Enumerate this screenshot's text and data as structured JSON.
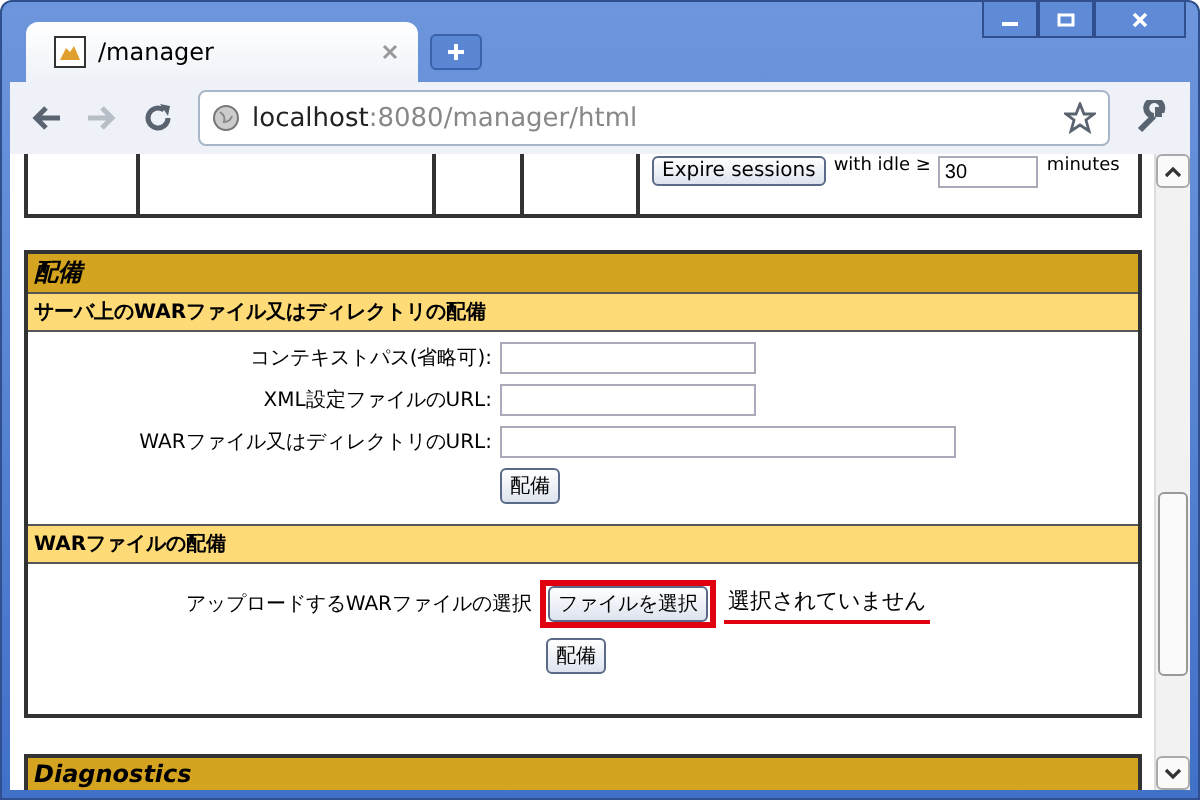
{
  "browser": {
    "tab_title": "/manager",
    "address_host": "localhost",
    "address_path": ":8080/manager/html"
  },
  "sessions_row": {
    "button": "Expire sessions",
    "idle_label": "with idle ≥",
    "idle_value": "30",
    "unit": "minutes"
  },
  "deploy": {
    "title": "配備",
    "server_section": {
      "title": "サーバ上のWARファイル又はディレクトリの配備",
      "fields": [
        {
          "label": "コンテキストパス(省略可):",
          "wide": false
        },
        {
          "label": "XML設定ファイルのURL:",
          "wide": false
        },
        {
          "label": "WARファイル又はディレクトリのURL:",
          "wide": true
        }
      ],
      "button": "配備"
    },
    "upload_section": {
      "title": "WARファイルの配備",
      "label": "アップロードするWARファイルの選択",
      "file_button": "ファイルを選択",
      "file_status": "選択されていません",
      "highlighted": true,
      "button": "配備"
    }
  },
  "diagnostics": {
    "title": "Diagnostics"
  }
}
